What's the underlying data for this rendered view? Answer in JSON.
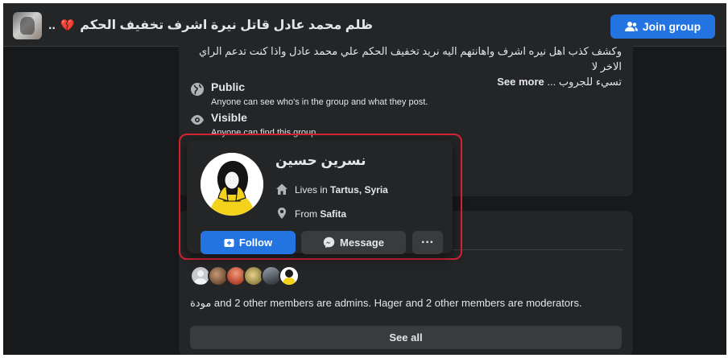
{
  "header": {
    "group_name": "ظلم محمد عادل قاتل نيرة اشرف تخفيف الحكم",
    "heart_glyph": "💔",
    "title_suffix": "..",
    "join_label": "Join group"
  },
  "about": {
    "description_line1": "وكشف كذب اهل نيره اشرف واهانتهم اليه نريد تخفيف الحكم علي محمد عادل واذا كنت تدعم الراي الاخر لا",
    "description_line2": "تسيء للجروب ...",
    "see_more": "See more",
    "privacy": {
      "title": "Public",
      "subtitle": "Anyone can see who's in the group and what they post."
    },
    "visibility": {
      "title": "Visible",
      "subtitle": "Anyone can find this group."
    }
  },
  "profile_card": {
    "name": "نسرين حسين",
    "lives_prefix": "Lives in",
    "lives_place": "Tartus, Syria",
    "from_prefix": "From",
    "from_place": "Safita",
    "follow_label": "Follow",
    "message_label": "Message",
    "more_label": "···"
  },
  "members": {
    "admins_text": "مودة and 2 other members are admins. Hager and 2 other members are moderators.",
    "see_all_label": "See all"
  },
  "colors": {
    "accent": "#2374e1",
    "highlight_frame": "#d82434",
    "background": "#18191a",
    "card": "#242526"
  }
}
